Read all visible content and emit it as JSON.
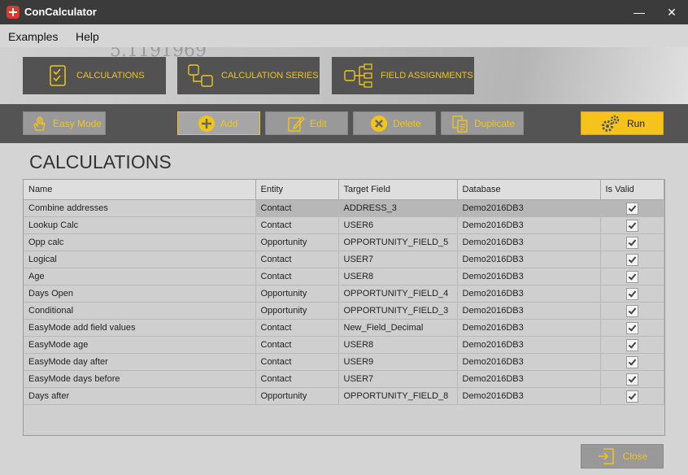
{
  "window": {
    "title": "ConCalculator"
  },
  "menu": {
    "examples": "Examples",
    "help": "Help"
  },
  "hero": {
    "background_number": "5.1191969",
    "tabs": [
      "CALCULATIONS",
      "CALCULATION SERIES",
      "FIELD ASSIGNMENTS"
    ]
  },
  "toolbar": {
    "easy_mode": "Easy Mode",
    "add": "Add",
    "edit": "Edit",
    "delete": "Delete",
    "duplicate": "Duplicate",
    "run": "Run"
  },
  "section_title": "CALCULATIONS",
  "table": {
    "columns": [
      "Name",
      "Entity",
      "Target Field",
      "Database",
      "Is Valid"
    ],
    "rows": [
      {
        "name": "Combine addresses",
        "entity": "Contact",
        "target": "ADDRESS_3",
        "db": "Demo2016DB3",
        "valid": true
      },
      {
        "name": "Lookup Calc",
        "entity": "Contact",
        "target": "USER6",
        "db": "Demo2016DB3",
        "valid": true
      },
      {
        "name": "Opp calc",
        "entity": "Opportunity",
        "target": "OPPORTUNITY_FIELD_5",
        "db": "Demo2016DB3",
        "valid": true
      },
      {
        "name": "Logical",
        "entity": "Contact",
        "target": "USER7",
        "db": "Demo2016DB3",
        "valid": true
      },
      {
        "name": "Age",
        "entity": "Contact",
        "target": "USER8",
        "db": "Demo2016DB3",
        "valid": true
      },
      {
        "name": "Days Open",
        "entity": "Opportunity",
        "target": "OPPORTUNITY_FIELD_4",
        "db": "Demo2016DB3",
        "valid": true
      },
      {
        "name": "Conditional",
        "entity": "Opportunity",
        "target": "OPPORTUNITY_FIELD_3",
        "db": "Demo2016DB3",
        "valid": true
      },
      {
        "name": "EasyMode add field values",
        "entity": "Contact",
        "target": "New_Field_Decimal",
        "db": "Demo2016DB3",
        "valid": true
      },
      {
        "name": "EasyMode age",
        "entity": "Contact",
        "target": "USER8",
        "db": "Demo2016DB3",
        "valid": true
      },
      {
        "name": "EasyMode day after",
        "entity": "Contact",
        "target": "USER9",
        "db": "Demo2016DB3",
        "valid": true
      },
      {
        "name": "EasyMode days before",
        "entity": "Contact",
        "target": "USER7",
        "db": "Demo2016DB3",
        "valid": true
      },
      {
        "name": "Days after",
        "entity": "Opportunity",
        "target": "OPPORTUNITY_FIELD_8",
        "db": "Demo2016DB3",
        "valid": true
      }
    ]
  },
  "footer": {
    "close": "Close"
  },
  "colors": {
    "accent": "#f0c419",
    "dark": "#545454",
    "run": "#f6c31e",
    "titlebar": "#3b3b3b"
  }
}
